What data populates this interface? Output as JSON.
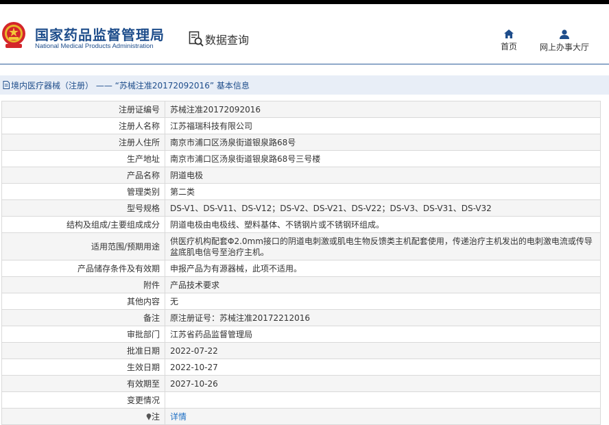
{
  "header": {
    "org_name_cn": "国家药品监督管理局",
    "org_name_en": "National Medical Products Administration",
    "data_query_label": "数据查询",
    "nav": {
      "home_label": "首页",
      "online_hall_label": "网上办事大厅"
    },
    "brand_color": "#1e4d8b"
  },
  "breadcrumb": {
    "text": "境内医疗器械（注册） —— “苏械注准20172092016” 基本信息"
  },
  "fields": [
    {
      "label": "注册证编号",
      "value": "苏械注准20172092016"
    },
    {
      "label": "注册人名称",
      "value": "江苏福瑞科技有限公司"
    },
    {
      "label": "注册人住所",
      "value": "南京市浦口区汤泉街道银泉路68号"
    },
    {
      "label": "生产地址",
      "value": "南京市浦口区汤泉街道银泉路68号三号楼"
    },
    {
      "label": "产品名称",
      "value": "阴道电极"
    },
    {
      "label": "管理类别",
      "value": "第二类"
    },
    {
      "label": "型号规格",
      "value": "DS-V1、DS-V11、DS-V12；DS-V2、DS-V21、DS-V22；DS-V3、DS-V31、DS-V32"
    },
    {
      "label": "结构及组成/主要组成成分",
      "value": "阴道电极由电极线、塑料基体、不锈钢片或不锈钢环组成。"
    },
    {
      "label": "适用范围/预期用途",
      "value": "供医疗机构配套Φ2.0mm接口的阴道电刺激或肌电生物反馈类主机配套使用，传递治疗主机发出的电刺激电流或传导盆底肌电信号至治疗主机。"
    },
    {
      "label": "产品储存条件及有效期",
      "value": "申报产品为有源器械，此项不适用。"
    },
    {
      "label": "附件",
      "value": "产品技术要求"
    },
    {
      "label": "其他内容",
      "value": "无"
    },
    {
      "label": "备注",
      "value": "原注册证号：苏械注准20172212016"
    },
    {
      "label": "审批部门",
      "value": "江苏省药品监督管理局"
    },
    {
      "label": "批准日期",
      "value": "2022-07-22"
    },
    {
      "label": "生效日期",
      "value": "2022-10-27"
    },
    {
      "label": "有效期至",
      "value": "2027-10-26"
    },
    {
      "label": "变更情况",
      "value": ""
    }
  ],
  "note": {
    "label": "注",
    "link_text": "详情"
  }
}
